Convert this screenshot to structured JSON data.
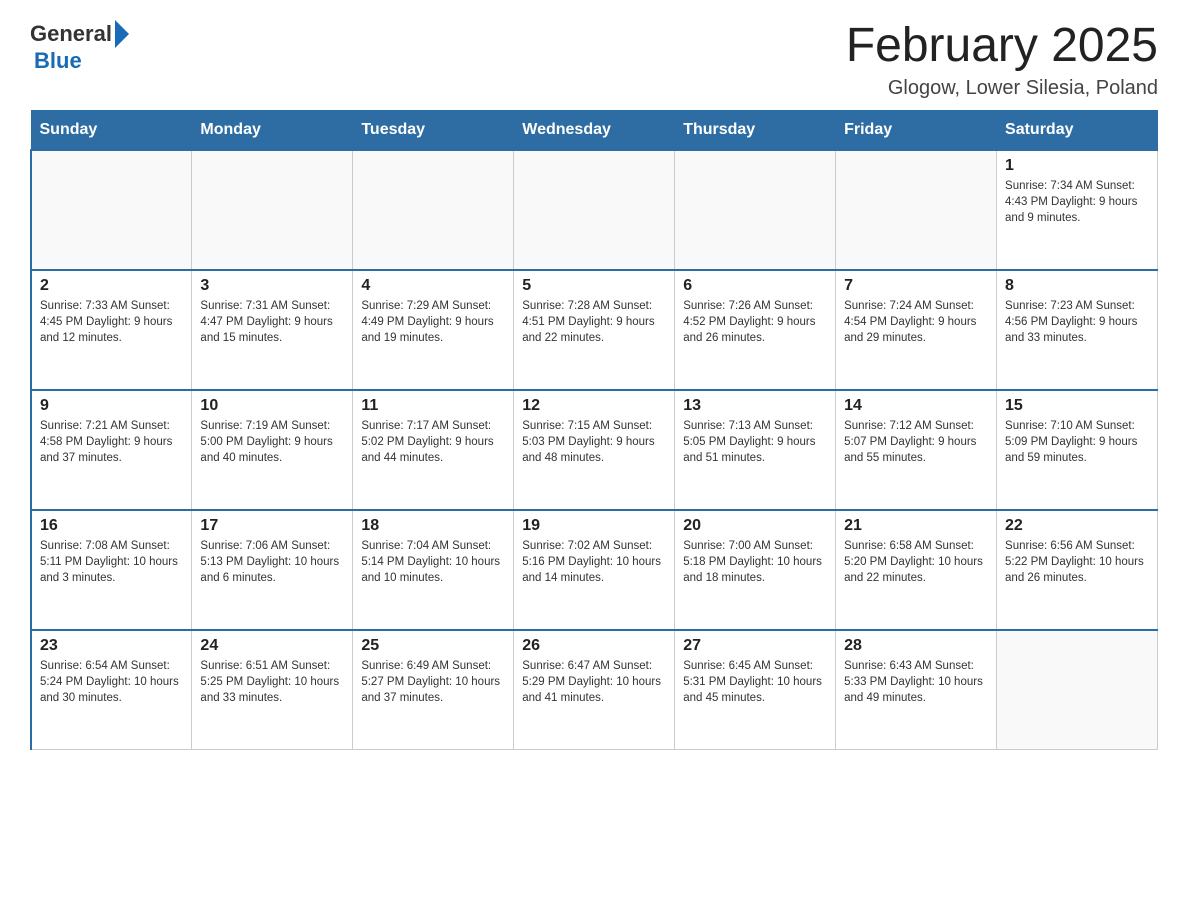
{
  "header": {
    "logo_general": "General",
    "logo_blue": "Blue",
    "title": "February 2025",
    "subtitle": "Glogow, Lower Silesia, Poland"
  },
  "weekdays": [
    "Sunday",
    "Monday",
    "Tuesday",
    "Wednesday",
    "Thursday",
    "Friday",
    "Saturday"
  ],
  "weeks": [
    [
      {
        "day": "",
        "info": ""
      },
      {
        "day": "",
        "info": ""
      },
      {
        "day": "",
        "info": ""
      },
      {
        "day": "",
        "info": ""
      },
      {
        "day": "",
        "info": ""
      },
      {
        "day": "",
        "info": ""
      },
      {
        "day": "1",
        "info": "Sunrise: 7:34 AM\nSunset: 4:43 PM\nDaylight: 9 hours and 9 minutes."
      }
    ],
    [
      {
        "day": "2",
        "info": "Sunrise: 7:33 AM\nSunset: 4:45 PM\nDaylight: 9 hours and 12 minutes."
      },
      {
        "day": "3",
        "info": "Sunrise: 7:31 AM\nSunset: 4:47 PM\nDaylight: 9 hours and 15 minutes."
      },
      {
        "day": "4",
        "info": "Sunrise: 7:29 AM\nSunset: 4:49 PM\nDaylight: 9 hours and 19 minutes."
      },
      {
        "day": "5",
        "info": "Sunrise: 7:28 AM\nSunset: 4:51 PM\nDaylight: 9 hours and 22 minutes."
      },
      {
        "day": "6",
        "info": "Sunrise: 7:26 AM\nSunset: 4:52 PM\nDaylight: 9 hours and 26 minutes."
      },
      {
        "day": "7",
        "info": "Sunrise: 7:24 AM\nSunset: 4:54 PM\nDaylight: 9 hours and 29 minutes."
      },
      {
        "day": "8",
        "info": "Sunrise: 7:23 AM\nSunset: 4:56 PM\nDaylight: 9 hours and 33 minutes."
      }
    ],
    [
      {
        "day": "9",
        "info": "Sunrise: 7:21 AM\nSunset: 4:58 PM\nDaylight: 9 hours and 37 minutes."
      },
      {
        "day": "10",
        "info": "Sunrise: 7:19 AM\nSunset: 5:00 PM\nDaylight: 9 hours and 40 minutes."
      },
      {
        "day": "11",
        "info": "Sunrise: 7:17 AM\nSunset: 5:02 PM\nDaylight: 9 hours and 44 minutes."
      },
      {
        "day": "12",
        "info": "Sunrise: 7:15 AM\nSunset: 5:03 PM\nDaylight: 9 hours and 48 minutes."
      },
      {
        "day": "13",
        "info": "Sunrise: 7:13 AM\nSunset: 5:05 PM\nDaylight: 9 hours and 51 minutes."
      },
      {
        "day": "14",
        "info": "Sunrise: 7:12 AM\nSunset: 5:07 PM\nDaylight: 9 hours and 55 minutes."
      },
      {
        "day": "15",
        "info": "Sunrise: 7:10 AM\nSunset: 5:09 PM\nDaylight: 9 hours and 59 minutes."
      }
    ],
    [
      {
        "day": "16",
        "info": "Sunrise: 7:08 AM\nSunset: 5:11 PM\nDaylight: 10 hours and 3 minutes."
      },
      {
        "day": "17",
        "info": "Sunrise: 7:06 AM\nSunset: 5:13 PM\nDaylight: 10 hours and 6 minutes."
      },
      {
        "day": "18",
        "info": "Sunrise: 7:04 AM\nSunset: 5:14 PM\nDaylight: 10 hours and 10 minutes."
      },
      {
        "day": "19",
        "info": "Sunrise: 7:02 AM\nSunset: 5:16 PM\nDaylight: 10 hours and 14 minutes."
      },
      {
        "day": "20",
        "info": "Sunrise: 7:00 AM\nSunset: 5:18 PM\nDaylight: 10 hours and 18 minutes."
      },
      {
        "day": "21",
        "info": "Sunrise: 6:58 AM\nSunset: 5:20 PM\nDaylight: 10 hours and 22 minutes."
      },
      {
        "day": "22",
        "info": "Sunrise: 6:56 AM\nSunset: 5:22 PM\nDaylight: 10 hours and 26 minutes."
      }
    ],
    [
      {
        "day": "23",
        "info": "Sunrise: 6:54 AM\nSunset: 5:24 PM\nDaylight: 10 hours and 30 minutes."
      },
      {
        "day": "24",
        "info": "Sunrise: 6:51 AM\nSunset: 5:25 PM\nDaylight: 10 hours and 33 minutes."
      },
      {
        "day": "25",
        "info": "Sunrise: 6:49 AM\nSunset: 5:27 PM\nDaylight: 10 hours and 37 minutes."
      },
      {
        "day": "26",
        "info": "Sunrise: 6:47 AM\nSunset: 5:29 PM\nDaylight: 10 hours and 41 minutes."
      },
      {
        "day": "27",
        "info": "Sunrise: 6:45 AM\nSunset: 5:31 PM\nDaylight: 10 hours and 45 minutes."
      },
      {
        "day": "28",
        "info": "Sunrise: 6:43 AM\nSunset: 5:33 PM\nDaylight: 10 hours and 49 minutes."
      },
      {
        "day": "",
        "info": ""
      }
    ]
  ]
}
